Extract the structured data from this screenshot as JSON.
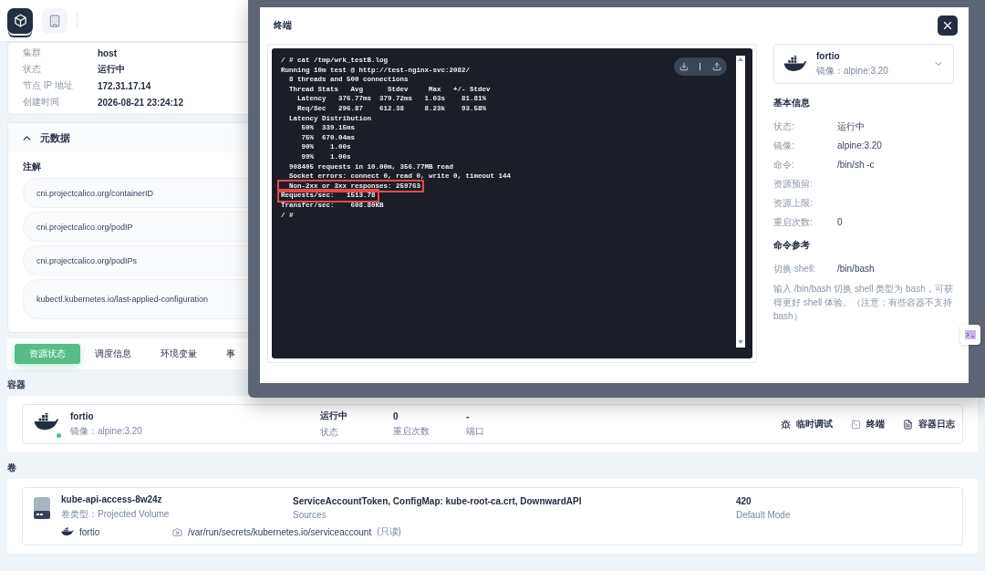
{
  "header": {
    "icon_tabs": [
      {
        "kind": "box",
        "selected": true
      },
      {
        "kind": "building",
        "selected": false
      }
    ]
  },
  "details": [
    {
      "label": "集群",
      "value": "host"
    },
    {
      "label": "状态",
      "value": "运行中"
    },
    {
      "label": "节点 IP 地址",
      "value": "172.31.17.14"
    },
    {
      "label": "创建时间",
      "value": "2026-08-21 23:24:12"
    }
  ],
  "metadata": {
    "title": "元数据",
    "expanded": true,
    "annotations_label": "注解",
    "annotations": [
      "cni.projectcalico.org/containerID",
      "cni.projectcalico.org/podIP",
      "cni.projectcalico.org/podIPs",
      "kubectl.kubernetes.io/last-applied-configuration"
    ]
  },
  "tabs": [
    {
      "label": "资源状态",
      "selected": true
    },
    {
      "label": "调度信息",
      "selected": false
    },
    {
      "label": "环境变量",
      "selected": false
    },
    {
      "label": "事",
      "selected": false
    }
  ],
  "containers": {
    "title": "容器",
    "items": [
      {
        "name": "fortio",
        "image": "镜像：alpine:3.20",
        "running": true,
        "status": "运行中",
        "status_label": "状态",
        "restarts": "0",
        "restarts_label": "重启次数",
        "ports": "-",
        "ports_label": "端口",
        "actions": [
          {
            "kind": "debug",
            "label": "临时调试"
          },
          {
            "kind": "terminal",
            "label": "终端"
          },
          {
            "kind": "logs",
            "label": "容器日志"
          }
        ]
      }
    ]
  },
  "volumes": {
    "title": "卷",
    "items": [
      {
        "name": "kube-api-access-8w24z",
        "type": "卷类型：Projected Volume",
        "sources": "ServiceAccountToken, ConfigMap: kube-root-ca.crt, DownwardAPI",
        "sources_label": "Sources",
        "mode": "420",
        "mode_label": "Default Mode",
        "container": "fortio",
        "mount_path": "/var/run/secrets/kubernetes.io/serviceaccount",
        "mount_note": "(只读)"
      }
    ]
  },
  "terminal_dialog": {
    "title": "终端",
    "lines": [
      {
        "text": "/ # cat /tmp/wrk_testB.log",
        "highlighted": false
      },
      {
        "text": "Running 10m test @ http://test-nginx-svc:2082/",
        "highlighted": false
      },
      {
        "text": "  8 threads and 500 connections",
        "highlighted": false
      },
      {
        "text": "  Thread Stats   Avg      Stdev     Max   +/- Stdev",
        "highlighted": false
      },
      {
        "text": "    Latency   376.77ms  379.72ms   1.03s    81.81%",
        "highlighted": false
      },
      {
        "text": "    Req/Sec   296.87    612.38     8.23k    93.58%",
        "highlighted": false
      },
      {
        "text": "  Latency Distribution",
        "highlighted": false
      },
      {
        "text": "     50%  339.15ms",
        "highlighted": false
      },
      {
        "text": "     75%  670.04ms",
        "highlighted": false
      },
      {
        "text": "     90%    1.00s",
        "highlighted": false
      },
      {
        "text": "     99%    1.00s",
        "highlighted": false
      },
      {
        "text": "  908405 requests in 10.00m, 356.77MB read",
        "highlighted": false
      },
      {
        "text": "  Socket errors: connect 0, read 0, write 0, timeout 144",
        "highlighted": false
      },
      {
        "text": "  Non-2xx or 3xx responses: 259763",
        "highlighted": true
      },
      {
        "text": "Requests/sec:   1513.78",
        "highlighted": true
      },
      {
        "text": "Transfer/sec:    608.80KB",
        "highlighted": false
      },
      {
        "text": "/ #",
        "highlighted": false
      }
    ],
    "container_select": {
      "name": "fortio",
      "image": "镜像：alpine:3.20"
    },
    "basic_title": "基本信息",
    "fields": [
      {
        "label": "状态:",
        "value": "运行中"
      },
      {
        "label": "镜像:",
        "value": "alpine:3.20"
      },
      {
        "label": "命令:",
        "value": "/bin/sh -c"
      },
      {
        "label": "资源预留:"
      },
      {
        "label": "资源上限:"
      },
      {
        "label": "重启次数:",
        "value": "0"
      }
    ],
    "command_title": "命令参考",
    "shell_label": "切换 shell:",
    "shell_value": "/bin/bash",
    "note": "输入 /bin/bash 切换 shell 类型为 bash，可获得更好 shell 体验。（注意：有些容器不支持 bash）"
  }
}
